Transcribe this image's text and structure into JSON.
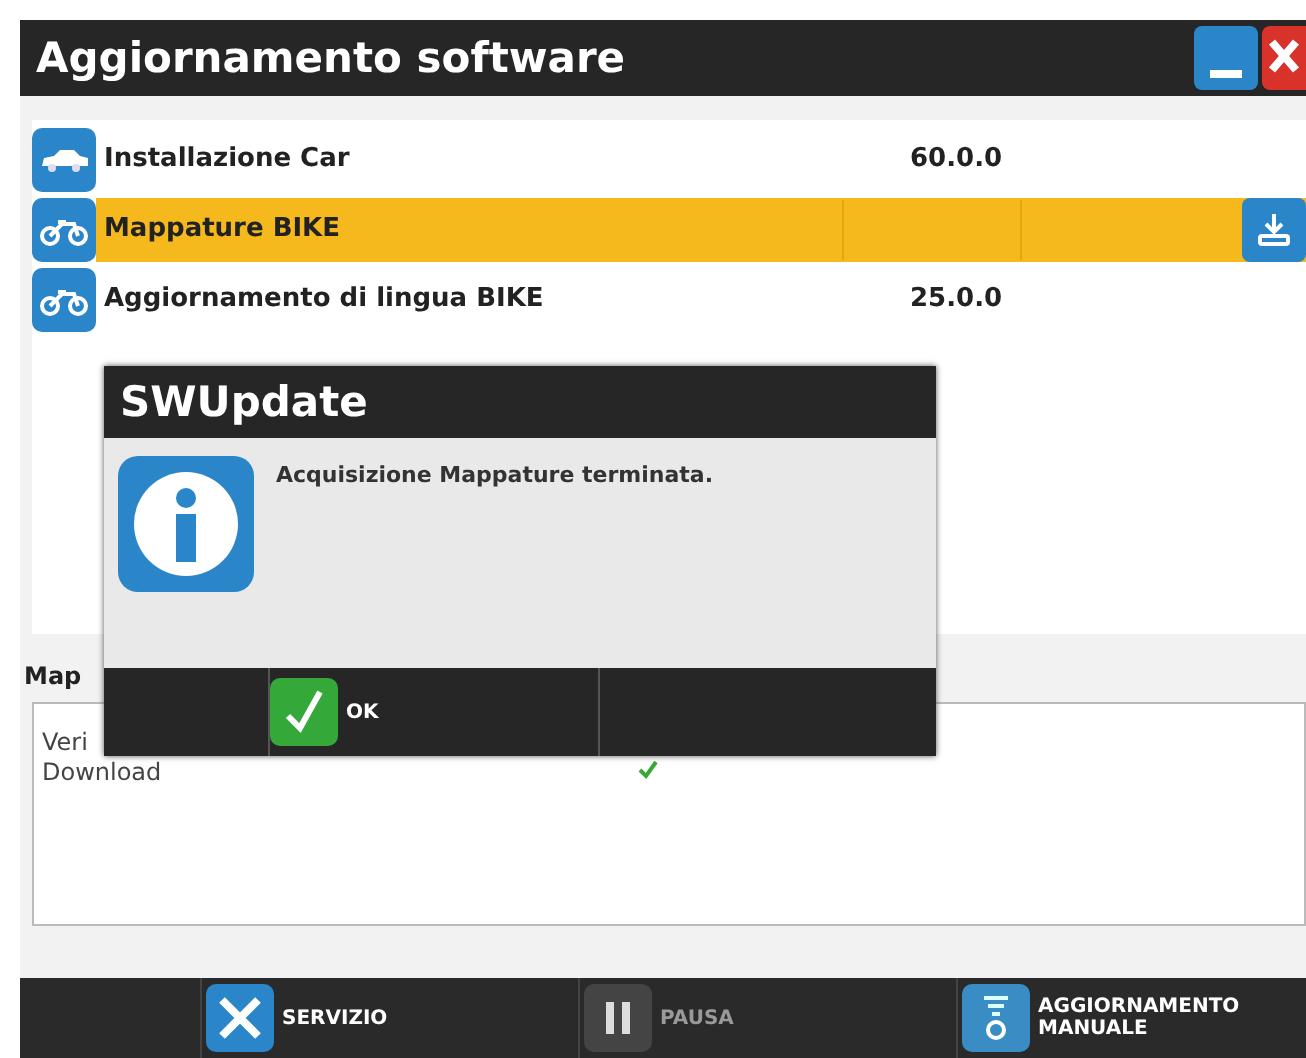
{
  "window": {
    "title": "Aggiornamento software"
  },
  "packages": [
    {
      "kind": "car",
      "name": "Installazione Car",
      "version": "60.0.0",
      "selected": false,
      "download": false
    },
    {
      "kind": "bike",
      "name": "Mappature BIKE",
      "selected": true,
      "download": true
    },
    {
      "kind": "bike",
      "name": "Aggiornamento di lingua BIKE",
      "version": "25.0.0",
      "selected": false,
      "download": false
    }
  ],
  "progress_panel": {
    "title": "Map",
    "steps": [
      {
        "label": "Veri"
      },
      {
        "label": "Download",
        "done": true
      }
    ]
  },
  "dialog": {
    "title": "SWUpdate",
    "message": "Acquisizione Mappature terminata.",
    "button": "OK"
  },
  "toolbar": [
    {
      "kind": "tools",
      "label": "SERVIZIO",
      "disabled": false
    },
    {
      "kind": "pause",
      "label": "PAUSA",
      "disabled": true
    },
    {
      "kind": "manual",
      "label": "AGGIORNAMENTO MANUALE",
      "disabled": false
    }
  ]
}
